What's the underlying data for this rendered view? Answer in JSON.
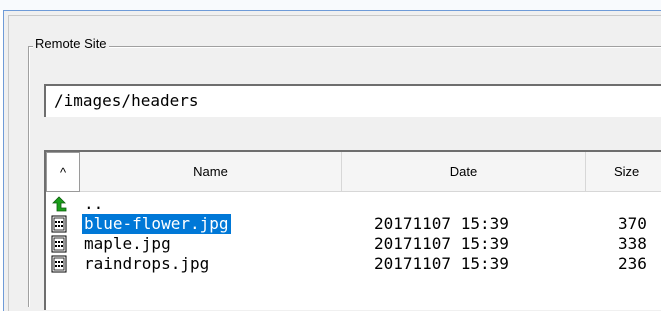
{
  "remote_site": {
    "group_title": "Remote Site",
    "path": "/images/headers"
  },
  "file_list": {
    "columns": {
      "sort": "^",
      "name": "Name",
      "date": "Date",
      "size": "Size"
    },
    "parent": {
      "name": "..",
      "icon": "up-arrow-icon"
    },
    "files": [
      {
        "name": "blue-flower.jpg",
        "date": "20171107 15:39",
        "size": "370",
        "selected": true,
        "icon": "image-file-icon"
      },
      {
        "name": "maple.jpg",
        "date": "20171107 15:39",
        "size": "338",
        "selected": false,
        "icon": "image-file-icon"
      },
      {
        "name": "raindrops.jpg",
        "date": "20171107 15:39",
        "size": "236",
        "selected": false,
        "icon": "image-file-icon"
      }
    ]
  },
  "colors": {
    "selection": "#0078d7",
    "window_border": "#6f9bd8",
    "up_arrow": "#1a9e1a"
  }
}
